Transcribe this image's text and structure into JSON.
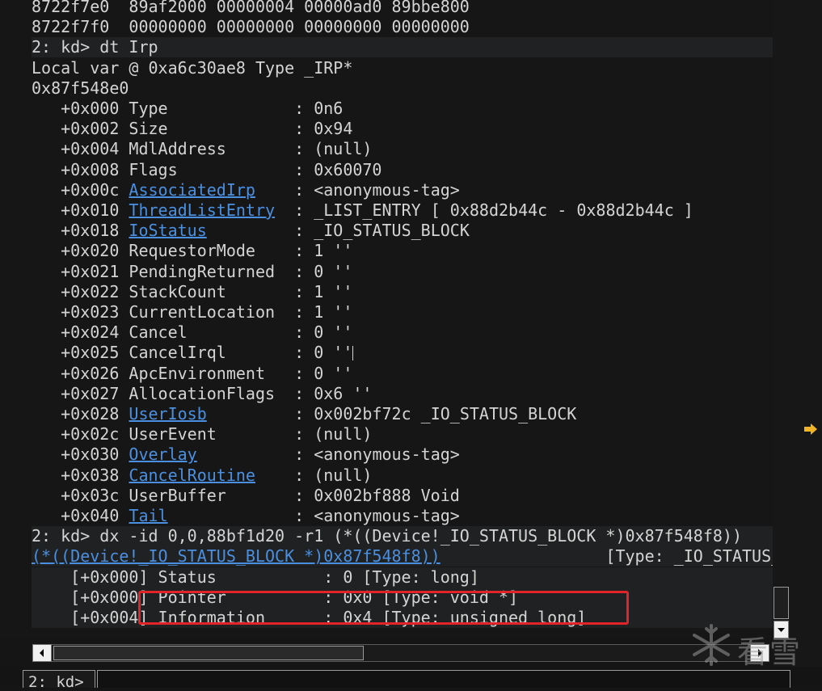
{
  "output_lines": [
    {
      "segments": [
        {
          "t": "8722f7e0  89af2000 00000004 00000ad0 89bbe800"
        }
      ]
    },
    {
      "segments": [
        {
          "t": "8722f7f0  00000000 00000000 00000000 00000000"
        }
      ]
    },
    {
      "hl": true,
      "segments": [
        {
          "t": "2: kd> dt Irp"
        }
      ]
    },
    {
      "segments": [
        {
          "t": "Local var @ 0xa6c30ae8 Type _IRP*"
        }
      ]
    },
    {
      "segments": [
        {
          "t": "0x87f548e0"
        }
      ]
    },
    {
      "segments": [
        {
          "t": "   +0x000 Type             : 0n6"
        }
      ]
    },
    {
      "segments": [
        {
          "t": "   +0x002 Size             : 0x94"
        }
      ]
    },
    {
      "segments": [
        {
          "t": "   +0x004 MdlAddress       : (null)"
        }
      ]
    },
    {
      "segments": [
        {
          "t": "   +0x008 Flags            : 0x60070"
        }
      ]
    },
    {
      "segments": [
        {
          "t": "   +0x00c "
        },
        {
          "t": "AssociatedIrp",
          "link": true
        },
        {
          "t": "    : <anonymous-tag>"
        }
      ]
    },
    {
      "segments": [
        {
          "t": "   +0x010 "
        },
        {
          "t": "ThreadListEntry",
          "link": true
        },
        {
          "t": "  : _LIST_ENTRY [ 0x88d2b44c - 0x88d2b44c ]"
        }
      ]
    },
    {
      "segments": [
        {
          "t": "   +0x018 "
        },
        {
          "t": "IoStatus",
          "link": true
        },
        {
          "t": "         : _IO_STATUS_BLOCK"
        }
      ]
    },
    {
      "segments": [
        {
          "t": "   +0x020 RequestorMode    : 1 ''"
        }
      ]
    },
    {
      "segments": [
        {
          "t": "   +0x021 PendingReturned  : 0 ''"
        }
      ]
    },
    {
      "segments": [
        {
          "t": "   +0x022 StackCount       : 1 ''"
        }
      ]
    },
    {
      "segments": [
        {
          "t": "   +0x023 CurrentLocation  : 1 ''"
        }
      ]
    },
    {
      "segments": [
        {
          "t": "   +0x024 Cancel           : 0 ''"
        }
      ]
    },
    {
      "cursor": true,
      "segments": [
        {
          "t": "   +0x025 CancelIrql       : 0 ''"
        }
      ]
    },
    {
      "segments": [
        {
          "t": "   +0x026 ApcEnvironment   : 0 ''"
        }
      ]
    },
    {
      "segments": [
        {
          "t": "   +0x027 AllocationFlags  : 0x6 ''"
        }
      ]
    },
    {
      "segments": [
        {
          "t": "   +0x028 "
        },
        {
          "t": "UserIosb",
          "link": true
        },
        {
          "t": "         : 0x002bf72c _IO_STATUS_BLOCK"
        }
      ]
    },
    {
      "segments": [
        {
          "t": "   +0x02c UserEvent        : (null)"
        }
      ]
    },
    {
      "segments": [
        {
          "t": "   +0x030 "
        },
        {
          "t": "Overlay",
          "link": true
        },
        {
          "t": "          : <anonymous-tag>"
        }
      ]
    },
    {
      "segments": [
        {
          "t": "   +0x038 "
        },
        {
          "t": "CancelRoutine",
          "link": true
        },
        {
          "t": "    : (null)"
        }
      ]
    },
    {
      "segments": [
        {
          "t": "   +0x03c UserBuffer       : 0x002bf888 Void"
        }
      ]
    },
    {
      "segments": [
        {
          "t": "   +0x040 "
        },
        {
          "t": "Tail",
          "link": true
        },
        {
          "t": "             : <anonymous-tag>"
        }
      ]
    },
    {
      "hl": true,
      "segments": [
        {
          "t": "2: kd> dx -id 0,0,88bf1d20 -r1 (*((Device!_IO_STATUS_BLOCK *)0x87f548f8))"
        }
      ]
    },
    {
      "hl": true,
      "segments": [
        {
          "t": "(*((Device!_IO_STATUS_BLOCK *)0x87f548f8))",
          "link": true
        },
        {
          "t": "                 [Type: _IO_STATUS_BLOCK]"
        }
      ]
    },
    {
      "hl": true,
      "segments": [
        {
          "t": "    [+0x000] Status           : 0 [Type: long]"
        }
      ]
    },
    {
      "hl": true,
      "segments": [
        {
          "t": "    [+0x000] Pointer          : 0x0 [Type: void *]"
        }
      ]
    },
    {
      "hl": true,
      "segments": [
        {
          "t": "    [+0x004] Information      : 0x4 [Type: unsigned long]"
        }
      ]
    }
  ],
  "command": {
    "prompt": "2: kd>",
    "input_value": ""
  },
  "watermark": {
    "text": "看雪",
    "icon": "snowflake-icon"
  },
  "icons": {
    "right_gutter": "arrow-right-icon",
    "vscroll_down": "chevron-down-icon",
    "hscroll_left": "chevron-left-icon",
    "hscroll_right": "chevron-right-icon"
  },
  "colors": {
    "background": "#161616",
    "text": "#d4d4d4",
    "link": "#4b8fe0",
    "highlight_row": "#202122",
    "annotation_box": "#e0242a",
    "gutter_arrow": "#f0b429"
  }
}
